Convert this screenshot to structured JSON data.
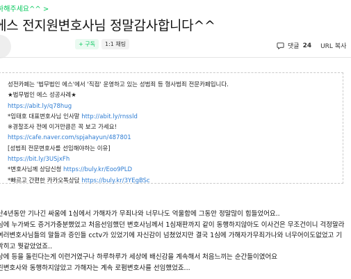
{
  "breadcrumb": "하해주세요^^ >",
  "title": "에스 전지원변호사님 정말감사합니다^^",
  "author": {
    "subscribe_label": "+ 구독",
    "chat_label": "1:1 채팅"
  },
  "actions": {
    "comment_label": "댓글",
    "comment_count": "24",
    "url_label": "URL 복사"
  },
  "quote_box": [
    {
      "text": "성전카페는 '법무법인 에스'에서 '직접' 운영하고 있는 성범죄 등 형사범죄 전문카페입니다.",
      "link": false
    },
    {
      "text": "★법무법인 에스 성공사례★",
      "link": false
    },
    {
      "text": "https://abit.ly/q78hug",
      "link": true
    },
    {
      "text": "*임태호 대표변호사님 인사말 http://abit.ly/rnssld",
      "link": false
    },
    {
      "text": "※경찰조사 전에 이거만큼은 꼭 보고 가세요!",
      "link": false
    },
    {
      "text": "https://cafe.naver.com/spjahayun/487801",
      "link": true
    },
    {
      "text": "[성범죄 전문변호사를 선임해야하는 이유]",
      "link": false
    },
    {
      "text": "https://bit.ly/3USjxFh",
      "link": true
    },
    {
      "text": "*변호사님께 상담신청 https://buly.kr/Eoo9PLD",
      "link": false
    },
    {
      "text": "*빠르고 간편한 카카오톡상담 https://buly.kr/3YEgBSc",
      "link": false
    }
  ],
  "body_lines": [
    "난4년동안 기나긴 싸움에 1심에서 가해자가 무죄나와 너무나도 억울함에 그동안 정말많이 힘들었어요..",
    "심에 누가봐도 증거가충분했었고 처음선임했던 변호사님께서 1심재판까지 같이 동행하지않아도 이사건은 무조건이니 걱정말라",
    " 여러변호사님들의 말들과 증인들 cctv가 있었기에 자신감이 넘쳤었지만 결국 1심에 가해자가무죄가나와 너무어이도없었고 기",
    "막히고 뭣같았었죠..",
    "상에 등을 돌린다는게 이런거였구나 하루하루가 세상에 배신감을 계속해서 처음느끼는 순간들이였어요",
    "린변호사와 동행하지않았고 가해자는 계속 로펌변호사를 선임했었죠..."
  ]
}
